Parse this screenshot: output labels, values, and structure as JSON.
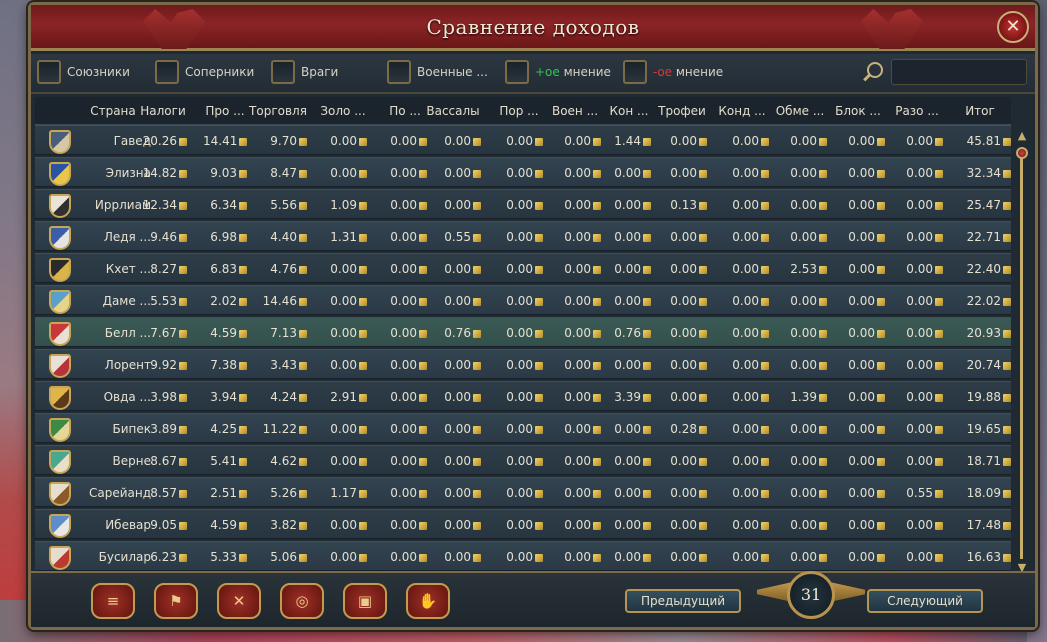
{
  "window": {
    "title": "Сравнение доходов",
    "close_label": "✕"
  },
  "filters": [
    {
      "label": "Союзники"
    },
    {
      "label": "Соперники"
    },
    {
      "label": "Враги"
    },
    {
      "label": "Военные ..."
    },
    {
      "prefix": "+ое",
      "label": " мнение"
    },
    {
      "prefix": "-ое",
      "label": " мнение"
    }
  ],
  "search": {
    "placeholder": ""
  },
  "columns": [
    "Страна",
    "Налоги",
    "Про ...",
    "Торговля",
    "Золо ...",
    "По ...",
    "Вассалы",
    "Пор ...",
    "Воен ...",
    "Кон ...",
    "Трофеи",
    "Конд ...",
    "Обме ...",
    "Блок ...",
    "Разо ...",
    "Итог"
  ],
  "rows": [
    {
      "name": "Гавед",
      "shield": [
        "#4a5d7a",
        "#d6c7a6"
      ],
      "values": [
        "20.26",
        "14.41",
        "9.70",
        "0.00",
        "0.00",
        "0.00",
        "0.00",
        "0.00",
        "1.44",
        "0.00",
        "0.00",
        "0.00",
        "0.00",
        "0.00",
        "45.81"
      ]
    },
    {
      "name": "Элизна",
      "shield": [
        "#2c53a0",
        "#e8c64a"
      ],
      "values": [
        "14.82",
        "9.03",
        "8.47",
        "0.00",
        "0.00",
        "0.00",
        "0.00",
        "0.00",
        "0.00",
        "0.00",
        "0.00",
        "0.00",
        "0.00",
        "0.00",
        "32.34"
      ]
    },
    {
      "name": "Иррлиам",
      "shield": [
        "#e9e4d5",
        "#303030"
      ],
      "values": [
        "12.34",
        "6.34",
        "5.56",
        "1.09",
        "0.00",
        "0.00",
        "0.00",
        "0.00",
        "0.00",
        "0.13",
        "0.00",
        "0.00",
        "0.00",
        "0.00",
        "25.47"
      ]
    },
    {
      "name": "Ледя ...",
      "shield": [
        "#3b5ea8",
        "#e5e5e5"
      ],
      "values": [
        "9.46",
        "6.98",
        "4.40",
        "1.31",
        "0.00",
        "0.55",
        "0.00",
        "0.00",
        "0.00",
        "0.00",
        "0.00",
        "0.00",
        "0.00",
        "0.00",
        "22.71"
      ]
    },
    {
      "name": "Кхет ...",
      "shield": [
        "#2a2a2a",
        "#d8b44a"
      ],
      "values": [
        "8.27",
        "6.83",
        "4.76",
        "0.00",
        "0.00",
        "0.00",
        "0.00",
        "0.00",
        "0.00",
        "0.00",
        "0.00",
        "2.53",
        "0.00",
        "0.00",
        "22.40"
      ]
    },
    {
      "name": "Даме ...",
      "shield": [
        "#5aa0c8",
        "#e5d58a"
      ],
      "values": [
        "5.53",
        "2.02",
        "14.46",
        "0.00",
        "0.00",
        "0.00",
        "0.00",
        "0.00",
        "0.00",
        "0.00",
        "0.00",
        "0.00",
        "0.00",
        "0.00",
        "22.02"
      ]
    },
    {
      "name": "Белл ...",
      "shield": [
        "#c8373a",
        "#e8e0d0"
      ],
      "values": [
        "7.67",
        "4.59",
        "7.13",
        "0.00",
        "0.00",
        "0.76",
        "0.00",
        "0.00",
        "0.76",
        "0.00",
        "0.00",
        "0.00",
        "0.00",
        "0.00",
        "20.93"
      ],
      "highlight": true
    },
    {
      "name": "Лорент",
      "shield": [
        "#e8e0d6",
        "#b5333a"
      ],
      "values": [
        "9.92",
        "7.38",
        "3.43",
        "0.00",
        "0.00",
        "0.00",
        "0.00",
        "0.00",
        "0.00",
        "0.00",
        "0.00",
        "0.00",
        "0.00",
        "0.00",
        "20.74"
      ]
    },
    {
      "name": "Овда ...",
      "shield": [
        "#e0b44a",
        "#5a3a1a"
      ],
      "values": [
        "3.98",
        "3.94",
        "4.24",
        "2.91",
        "0.00",
        "0.00",
        "0.00",
        "0.00",
        "3.39",
        "0.00",
        "0.00",
        "1.39",
        "0.00",
        "0.00",
        "19.88"
      ]
    },
    {
      "name": "Бипек",
      "shield": [
        "#3d8a44",
        "#e6d69a"
      ],
      "values": [
        "3.89",
        "4.25",
        "11.22",
        "0.00",
        "0.00",
        "0.00",
        "0.00",
        "0.00",
        "0.00",
        "0.28",
        "0.00",
        "0.00",
        "0.00",
        "0.00",
        "19.65"
      ]
    },
    {
      "name": "Верне",
      "shield": [
        "#4aa890",
        "#e8e0c6"
      ],
      "values": [
        "8.67",
        "5.41",
        "4.62",
        "0.00",
        "0.00",
        "0.00",
        "0.00",
        "0.00",
        "0.00",
        "0.00",
        "0.00",
        "0.00",
        "0.00",
        "0.00",
        "18.71"
      ]
    },
    {
      "name": "Сарейанд",
      "shield": [
        "#e6dfcf",
        "#8a5a2a"
      ],
      "values": [
        "8.57",
        "2.51",
        "5.26",
        "1.17",
        "0.00",
        "0.00",
        "0.00",
        "0.00",
        "0.00",
        "0.00",
        "0.00",
        "0.00",
        "0.00",
        "0.55",
        "18.09"
      ]
    },
    {
      "name": "Ибевар",
      "shield": [
        "#5c8fc9",
        "#e8e8e8"
      ],
      "values": [
        "9.05",
        "4.59",
        "3.82",
        "0.00",
        "0.00",
        "0.00",
        "0.00",
        "0.00",
        "0.00",
        "0.00",
        "0.00",
        "0.00",
        "0.00",
        "0.00",
        "17.48"
      ]
    },
    {
      "name": "Бусилар",
      "shield": [
        "#e6ddcf",
        "#b83a30"
      ],
      "values": [
        "6.23",
        "5.33",
        "5.06",
        "0.00",
        "0.00",
        "0.00",
        "0.00",
        "0.00",
        "0.00",
        "0.00",
        "0.00",
        "0.00",
        "0.00",
        "0.00",
        "16.63"
      ]
    }
  ],
  "footer": {
    "buttons": [
      {
        "icon": "scroll-icon",
        "glyph": "≡"
      },
      {
        "icon": "flag-icon",
        "glyph": "⚑"
      },
      {
        "icon": "crossed-swords-icon",
        "glyph": "✕"
      },
      {
        "icon": "gold-coins-icon",
        "glyph": "◎"
      },
      {
        "icon": "treasure-chest-icon",
        "glyph": "▣"
      },
      {
        "icon": "handshake-icon",
        "glyph": "✋"
      }
    ],
    "prev_label": "Предыдущий",
    "next_label": "Следующий",
    "page": "31"
  },
  "colors": {
    "title_bar": "#8c2426",
    "gold_border": "#c29b4f",
    "row_bg": "#2e3d47",
    "positive_opinion": "#36c25c",
    "negative_opinion": "#d8393b"
  }
}
